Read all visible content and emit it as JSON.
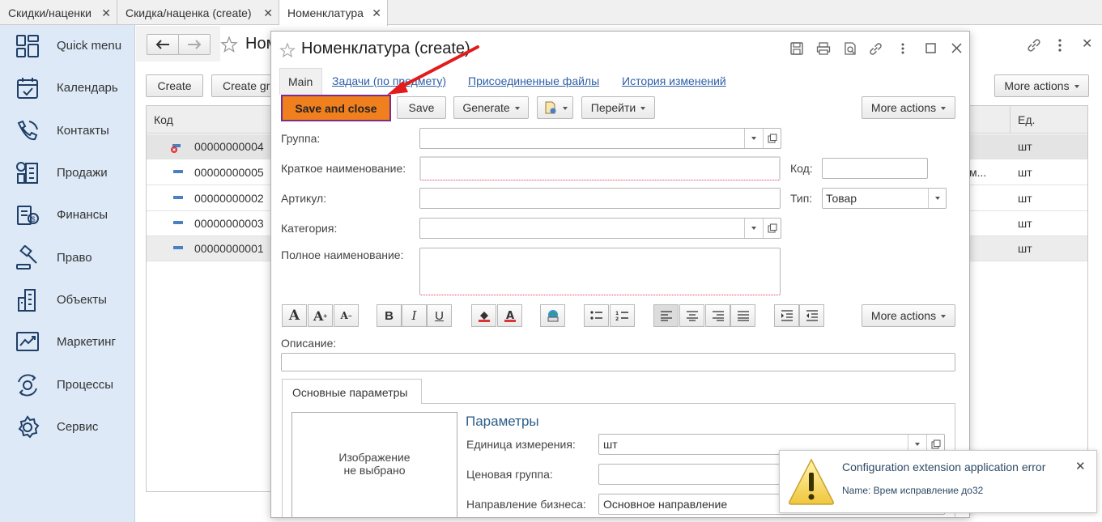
{
  "tabs": [
    {
      "label": "Скидки/наценки"
    },
    {
      "label": "Скидка/наценка (create)"
    },
    {
      "label": "Номенклатура"
    }
  ],
  "tab_close": "✕",
  "sidebar": {
    "items": [
      {
        "label": "Quick menu",
        "icon": "quick-menu-icon"
      },
      {
        "label": "Календарь",
        "icon": "calendar-icon"
      },
      {
        "label": "Контакты",
        "icon": "contacts-icon"
      },
      {
        "label": "Продажи",
        "icon": "sales-icon"
      },
      {
        "label": "Финансы",
        "icon": "finance-icon"
      },
      {
        "label": "Право",
        "icon": "law-icon"
      },
      {
        "label": "Объекты",
        "icon": "buildings-icon"
      },
      {
        "label": "Маркетинг",
        "icon": "marketing-icon"
      },
      {
        "label": "Процессы",
        "icon": "processes-icon"
      },
      {
        "label": "Сервис",
        "icon": "gear-icon"
      }
    ]
  },
  "list": {
    "title": "Ном",
    "buttons": {
      "create": "Create",
      "create_group": "Create gr",
      "more_actions": "More actions"
    },
    "columns": {
      "code": "Код",
      "unit": "Ед."
    },
    "rows": [
      {
        "code": "00000000004",
        "unit": "шт",
        "extra": ""
      },
      {
        "code": "00000000005",
        "unit": "шт",
        "extra": "ким..."
      },
      {
        "code": "00000000002",
        "unit": "шт",
        "extra": ""
      },
      {
        "code": "00000000003",
        "unit": "шт",
        "extra": ""
      },
      {
        "code": "00000000001",
        "unit": "шт",
        "extra": ""
      }
    ]
  },
  "modal": {
    "title": "Номенклатура (create)",
    "tabs": [
      "Main",
      "Задачи (по предмету)",
      "Присоединенные файлы",
      "История изменений"
    ],
    "toolbar": {
      "save_and_close": "Save and close",
      "save": "Save",
      "generate": "Generate",
      "goto": "Перейти",
      "more_actions": "More actions"
    },
    "fields": {
      "group_label": "Группа:",
      "group_value": "",
      "short_name_label": "Краткое наименование:",
      "short_name_value": "",
      "code_label": "Код:",
      "code_value": "",
      "article_label": "Артикул:",
      "article_value": "",
      "type_label": "Тип:",
      "type_value": "Товар",
      "category_label": "Категория:",
      "category_value": "",
      "full_name_label": "Полное наименование:",
      "full_name_value": "",
      "description_label": "Описание:",
      "description_value": ""
    },
    "format_more_actions": "More actions",
    "format_glyphs": {
      "bold": "B",
      "italic": "I",
      "underline": "U",
      "font": "A"
    },
    "subtab": "Основные параметры",
    "image_placeholder_line1": "Изображение",
    "image_placeholder_line2": "не выбрано",
    "params": {
      "heading": "Параметры",
      "unit_label": "Единица измерения:",
      "unit_value": "шт",
      "price_group_label": "Ценовая группа:",
      "price_group_value": "",
      "business_label": "Направление бизнеса:",
      "business_value": "Основное направление"
    }
  },
  "notification": {
    "title": "Configuration extension application error",
    "text": "Name: Врем исправление до32",
    "close": "✕"
  },
  "colors": {
    "accent_button": "#f07f1e",
    "accent_border": "#7b2d8b",
    "sidebar_bg": "#dde9f7",
    "link": "#2d5fa8",
    "annotation_arrow": "#e31b1b"
  }
}
